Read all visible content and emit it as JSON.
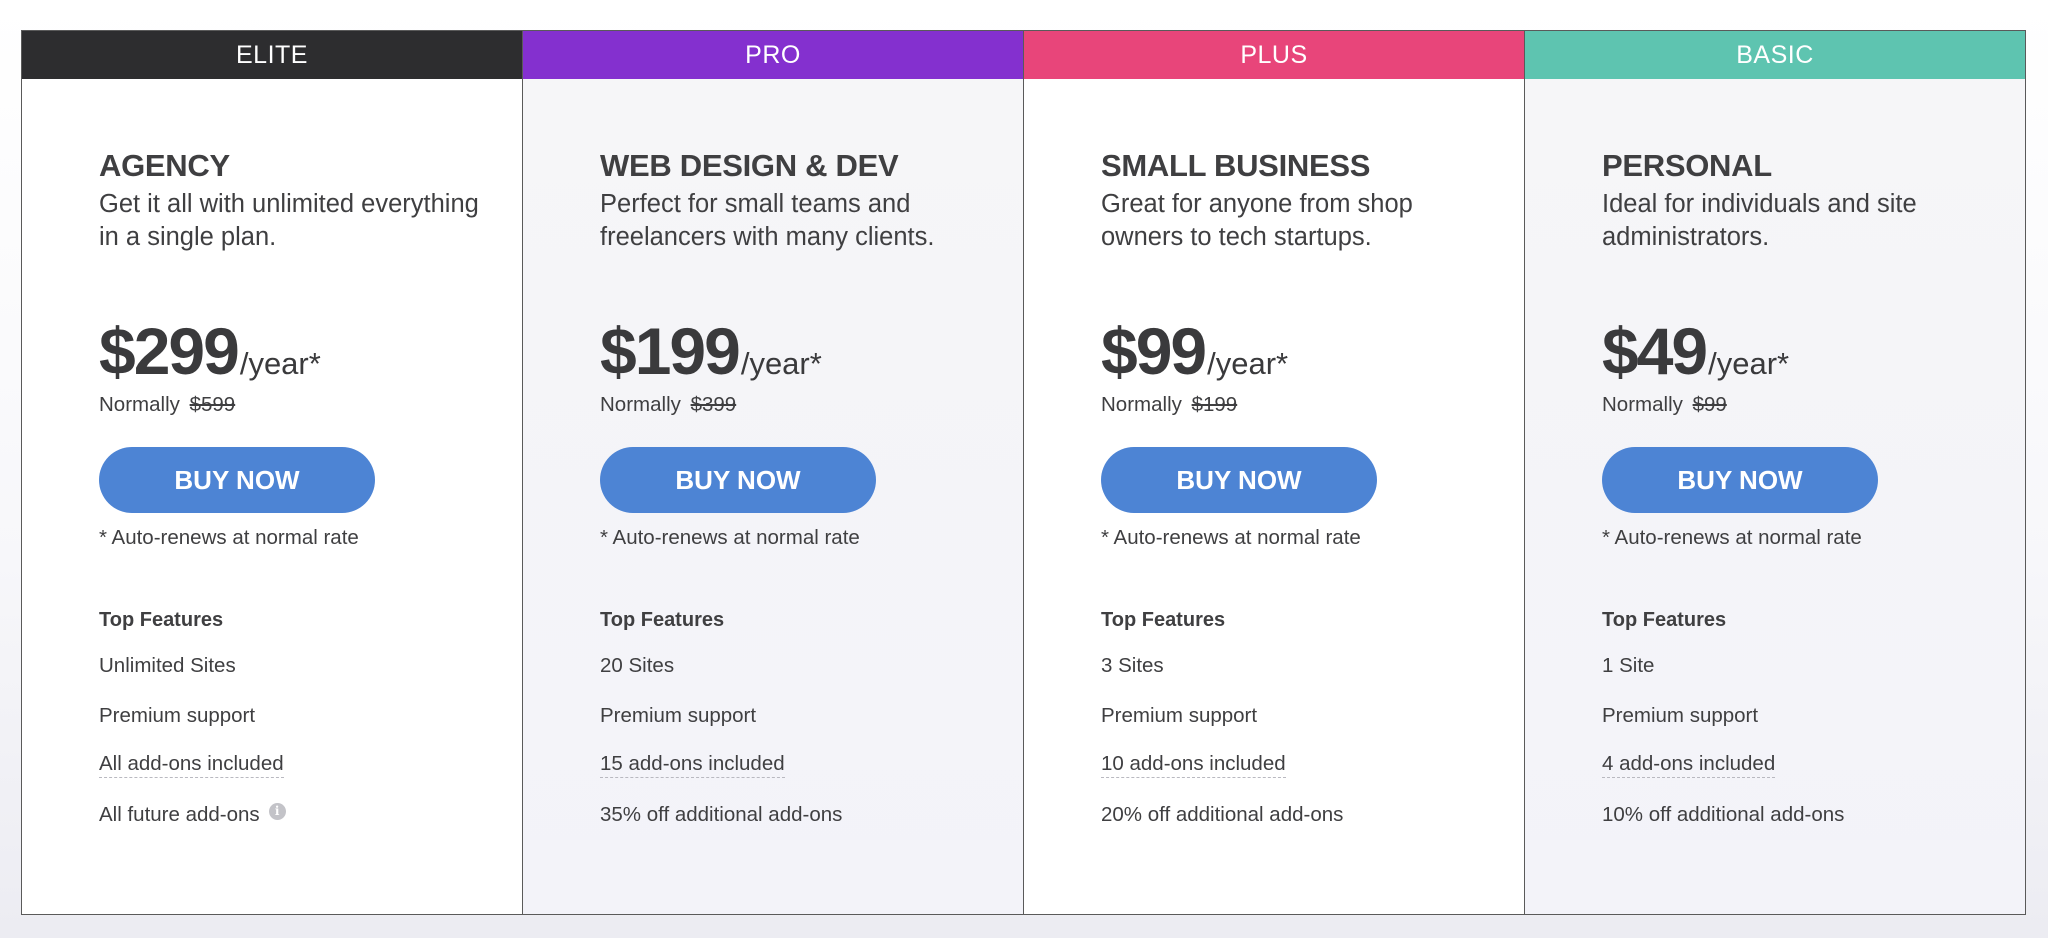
{
  "colors": {
    "elite": "#2d2d2f",
    "pro": "#8430cf",
    "plus": "#e8457a",
    "basic": "#5ec4b0",
    "button": "#4d84d4"
  },
  "plans": [
    {
      "tier": "ELITE",
      "name": "AGENCY",
      "description": "Get it all with unlimited everything in a single plan.",
      "price": "$299",
      "period": "/year*",
      "normally_label": "Normally",
      "normal_price": "$599",
      "button_label": "BUY NOW",
      "renew_note": "* Auto-renews at normal rate",
      "features_title": "Top Features",
      "features": [
        "Unlimited Sites",
        "Premium support",
        "All add-ons included",
        "All future add-ons"
      ],
      "info_icon": "i"
    },
    {
      "tier": "PRO",
      "name": "WEB DESIGN & DEV",
      "description": "Perfect for small teams and freelancers with many clients.",
      "price": "$199",
      "period": "/year*",
      "normally_label": "Normally",
      "normal_price": "$399",
      "button_label": "BUY NOW",
      "renew_note": "* Auto-renews at normal rate",
      "features_title": "Top Features",
      "features": [
        "20 Sites",
        "Premium support",
        "15 add-ons included",
        "35% off additional add-ons"
      ]
    },
    {
      "tier": "PLUS",
      "name": "SMALL BUSINESS",
      "description": "Great for anyone from shop owners to tech startups.",
      "price": "$99",
      "period": "/year*",
      "normally_label": "Normally",
      "normal_price": "$199",
      "button_label": "BUY NOW",
      "renew_note": "* Auto-renews at normal rate",
      "features_title": "Top Features",
      "features": [
        "3 Sites",
        "Premium support",
        "10 add-ons included",
        "20% off additional add-ons"
      ]
    },
    {
      "tier": "BASIC",
      "name": "PERSONAL",
      "description": "Ideal for individuals and site administrators.",
      "price": "$49",
      "period": "/year*",
      "normally_label": "Normally",
      "normal_price": "$99",
      "button_label": "BUY NOW",
      "renew_note": "* Auto-renews at normal rate",
      "features_title": "Top Features",
      "features": [
        "1 Site",
        "Premium support",
        "4 add-ons included",
        "10% off additional add-ons"
      ]
    }
  ]
}
